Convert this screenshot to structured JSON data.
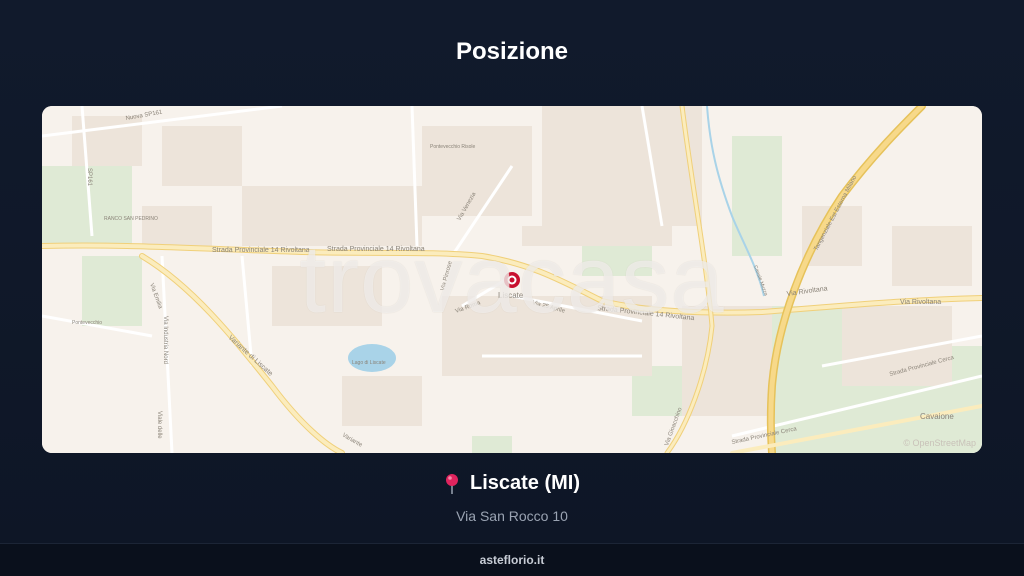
{
  "page": {
    "title": "Posizione"
  },
  "map": {
    "watermark": "trovacasa",
    "marker_label": "Liscate",
    "copyright": "© OpenStreetMap",
    "labels": {
      "sp14_west": "Strada Provinciale 14 Rivoltana",
      "sp14_mid": "Strada Provinciale 14 Rivoltana",
      "sp14_east": "Strada Provinciale 14 Rivoltana",
      "via_rivoltana_1": "Via Rivoltana",
      "via_rivoltana_2": "Via Rivoltana",
      "nuova_sp161": "Nuova SP161",
      "sp161": "SP161",
      "ranco": "RANCO SAN PEDRINO",
      "via_emilia": "Via Emilia",
      "via_industria": "Via Industria Nord",
      "viale_delle": "Viale delle",
      "variante": "Variante di Liscate",
      "variante2": "Variante",
      "lago": "Lago di Liscate",
      "pontevecchio": "Pontevecchio",
      "pontevecchio2": "Pontevecchio Risole",
      "via_venezia": "Via Venezia",
      "via_roma": "Via Roma",
      "via_aprile": "Via 25 Aprile",
      "via_pinrose": "Via Pinrose",
      "via_gioacchino": "Via Gioacchino",
      "sp_cerca": "Strada Provinciale Cerca",
      "sp_cerca2": "Strada Provinciale Cerca",
      "tangenziale": "Tangenziale Est Esterna Milano",
      "cavaione": "Cavaione",
      "canale": "Canale Muzza"
    }
  },
  "location": {
    "pin_icon": "round-pushpin-icon",
    "name": "Liscate (MI)",
    "address": "Via San Rocco 10"
  },
  "footer": {
    "site": "asteflorio.it"
  },
  "colors": {
    "background": "#111a2c",
    "marker": "#c8102e",
    "highway": "#f3d98a",
    "road": "#fbecbd",
    "water": "#a9d3e8",
    "green": "#d9ead0"
  }
}
